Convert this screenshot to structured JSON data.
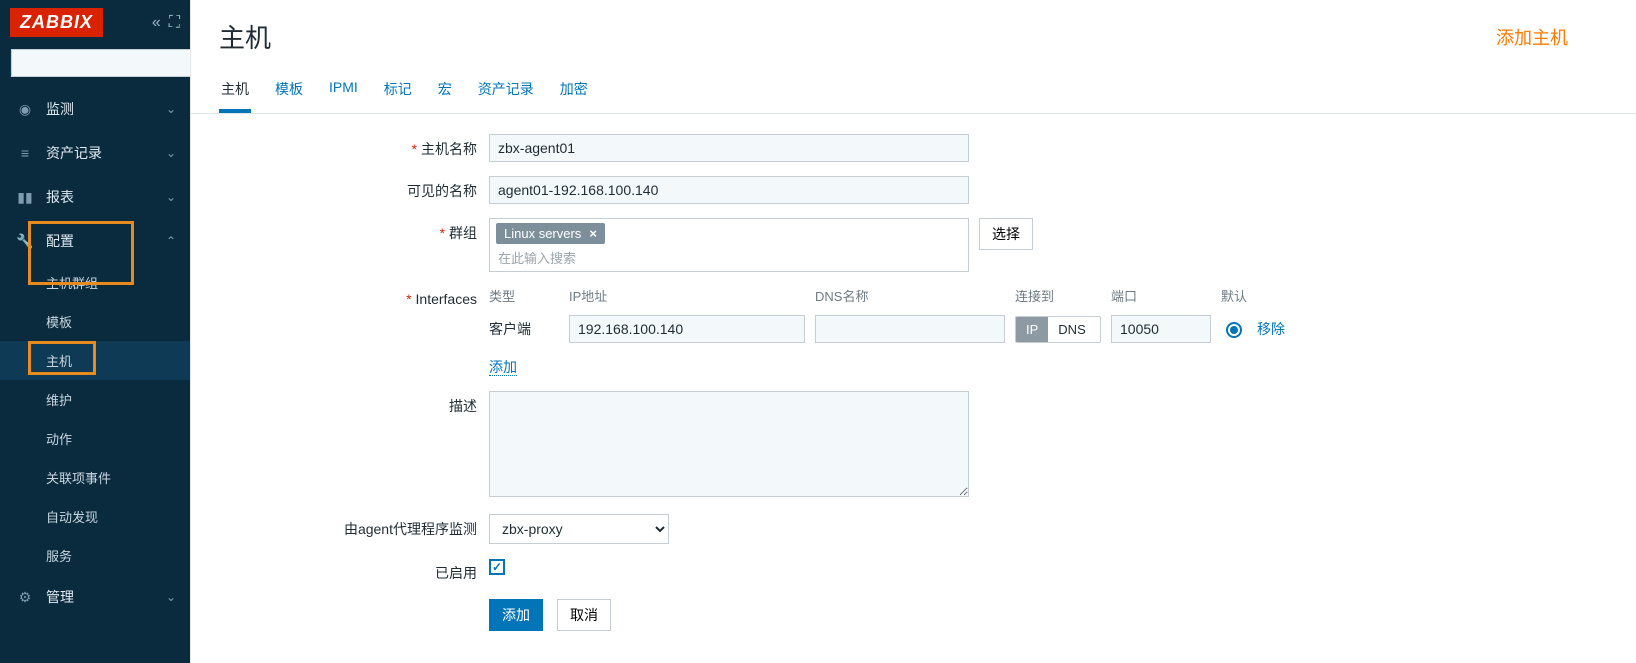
{
  "brand": "ZABBIX",
  "sidebar": {
    "sections": [
      {
        "icon": "◉",
        "label": "监测",
        "chev": "⌄"
      },
      {
        "icon": "≡",
        "label": "资产记录",
        "chev": "⌄"
      },
      {
        "icon": "⬛",
        "label": "报表",
        "chev": "⌄"
      },
      {
        "icon": "🔧",
        "label": "配置",
        "chev": "⌃"
      },
      {
        "icon": "⚙",
        "label": "管理",
        "chev": "⌄"
      }
    ],
    "config_items": [
      "主机群组",
      "模板",
      "主机",
      "维护",
      "动作",
      "关联项事件",
      "自动发现",
      "服务"
    ]
  },
  "page": {
    "title": "主机",
    "add_host": "添加主机"
  },
  "tabs": [
    "主机",
    "模板",
    "IPMI",
    "标记",
    "宏",
    "资产记录",
    "加密"
  ],
  "labels": {
    "host_name": "主机名称",
    "visible_name": "可见的名称",
    "groups": "群组",
    "groups_placeholder": "在此输入搜索",
    "select": "选择",
    "interfaces": "Interfaces",
    "col_type": "类型",
    "col_ip": "IP地址",
    "col_dns": "DNS名称",
    "col_conn": "连接到",
    "col_port": "端口",
    "col_default": "默认",
    "row_agent": "客户端",
    "btn_ip": "IP",
    "btn_dns": "DNS",
    "remove": "移除",
    "add_iface": "添加",
    "description": "描述",
    "monitored_by": "由agent代理程序监测",
    "enabled": "已启用",
    "btn_add": "添加",
    "btn_cancel": "取消"
  },
  "values": {
    "host_name": "zbx-agent01",
    "visible_name": "agent01-192.168.100.140",
    "group_tag": "Linux servers",
    "iface_ip": "192.168.100.140",
    "iface_dns": "",
    "iface_port": "10050",
    "description": "",
    "proxy": "zbx-proxy",
    "enabled": true,
    "connect_to": "IP",
    "default_iface": true
  }
}
